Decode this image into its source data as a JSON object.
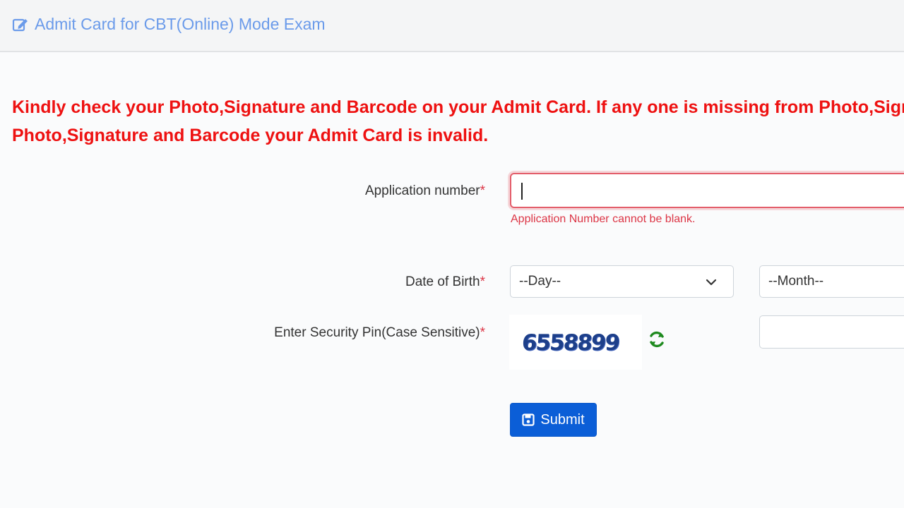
{
  "header": {
    "title": "Admit Card for CBT(Online) Mode Exam",
    "icon": "edit-icon"
  },
  "notice": {
    "line1": "Kindly check your Photo,Signature and Barcode on your Admit Card. If any one is missing from Photo,Signature and Barcode your Admit Card is invalid.",
    "line2": "Photo,Signature and Barcode your Admit Card is invalid.",
    "color": "#ee1111"
  },
  "form": {
    "application_number": {
      "label": "Application number",
      "required_mark": "*",
      "value": "",
      "error": "Application Number cannot be blank."
    },
    "dob": {
      "label": "Date of Birth",
      "required_mark": "*",
      "day_selected": "--Day--",
      "month_selected": "--Month--"
    },
    "security_pin": {
      "label": "Enter Security Pin(Case Sensitive)",
      "required_mark": "*",
      "captcha_text": "6558899",
      "refresh_icon": "refresh-icon",
      "value": ""
    },
    "submit_label": "Submit",
    "submit_icon": "save-icon"
  },
  "colors": {
    "header_text": "#6b9bea",
    "error": "#dc3545",
    "primary_button": "#0b5ed7",
    "refresh_icon": "#1e8a1e"
  }
}
